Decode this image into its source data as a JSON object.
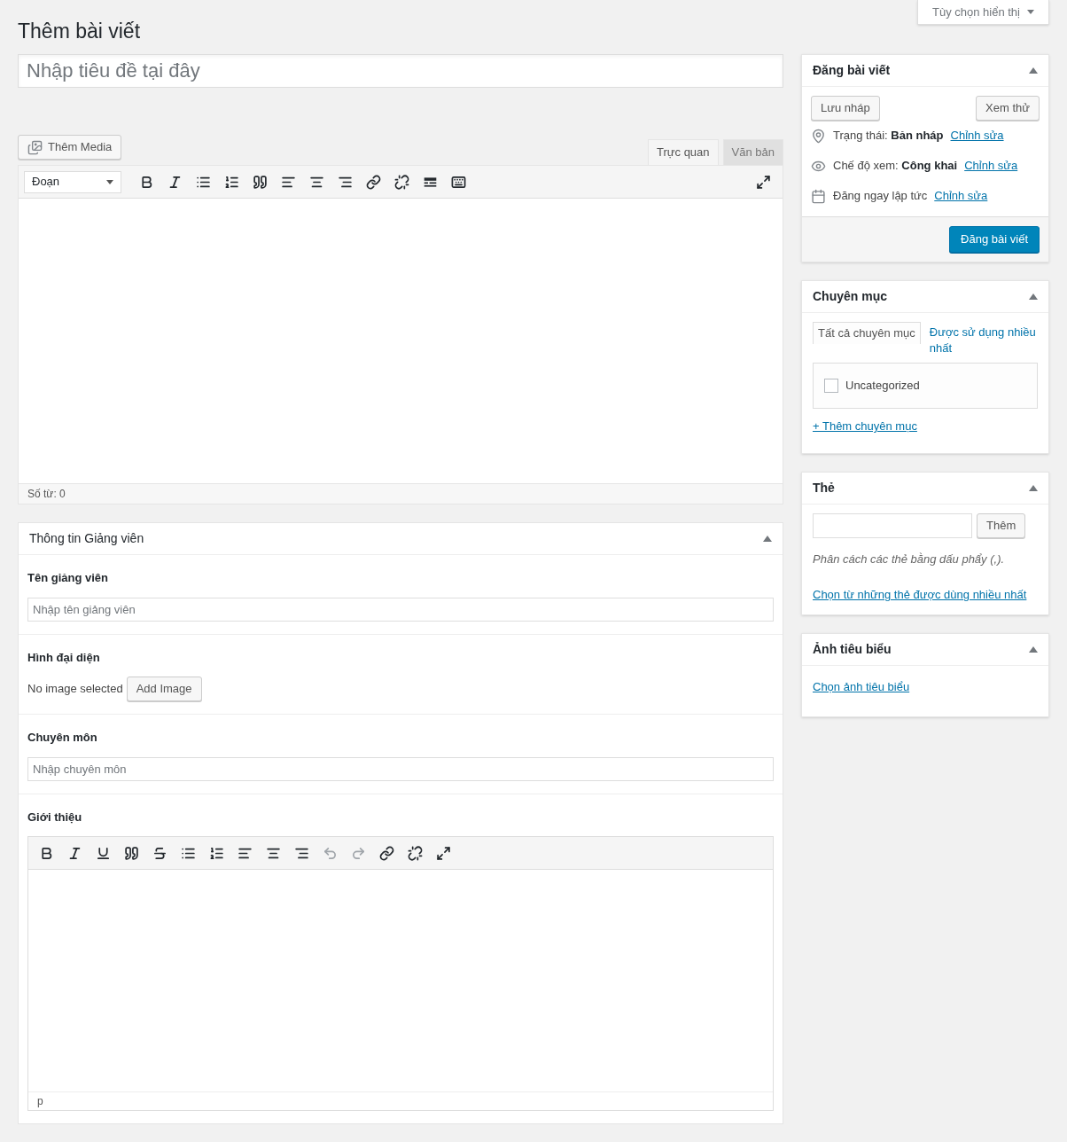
{
  "screen_options": {
    "label": "Tùy chọn hiển thị"
  },
  "page_title": "Thêm bài viết",
  "title_field": {
    "placeholder": "Nhập tiêu đề tại đây"
  },
  "add_media": "Thêm Media",
  "editor_tabs": [
    {
      "label": "Trực quan",
      "selected": true
    },
    {
      "label": "Văn bản",
      "selected": false
    }
  ],
  "format_select": "Đoạn",
  "toolbar": [
    {
      "kind": "bold"
    },
    {
      "kind": "italic"
    },
    {
      "kind": "bullets"
    },
    {
      "kind": "numbers"
    },
    {
      "kind": "quote"
    },
    {
      "kind": "align-left"
    },
    {
      "kind": "align-center"
    },
    {
      "kind": "align-right"
    },
    {
      "kind": "link"
    },
    {
      "kind": "unlink"
    },
    {
      "kind": "more"
    },
    {
      "kind": "kitchen"
    }
  ],
  "word_count": "Số từ: 0",
  "metabox": {
    "title": "Thông tin Giảng viên",
    "fields": [
      {
        "kind": "text",
        "label": "Tên giảng viên",
        "placeholder": "Nhập tên giảng viên"
      },
      {
        "kind": "image",
        "label": "Hình đại diện",
        "status": "No image selected",
        "button": "Add Image"
      },
      {
        "kind": "text",
        "label": "Chuyên môn",
        "placeholder": "Nhập chuyên môn"
      },
      {
        "kind": "editor",
        "label": "Giới thiệu",
        "path": "p",
        "toolbar": [
          {
            "kind": "bold",
            "disabled": false
          },
          {
            "kind": "italic",
            "disabled": false
          },
          {
            "kind": "underline",
            "disabled": false
          },
          {
            "kind": "quote",
            "disabled": false
          },
          {
            "kind": "strike",
            "disabled": false
          },
          {
            "kind": "bullets",
            "disabled": false
          },
          {
            "kind": "numbers",
            "disabled": false
          },
          {
            "kind": "align-left",
            "disabled": false
          },
          {
            "kind": "align-center",
            "disabled": false
          },
          {
            "kind": "align-right",
            "disabled": false
          },
          {
            "kind": "undo",
            "disabled": true
          },
          {
            "kind": "redo",
            "disabled": true
          },
          {
            "kind": "link",
            "disabled": false
          },
          {
            "kind": "unlink",
            "disabled": false
          },
          {
            "kind": "fullscreen",
            "disabled": false
          }
        ]
      }
    ]
  },
  "publish": {
    "title": "Đăng bài viết",
    "save_draft": "Lưu nháp",
    "preview": "Xem thử",
    "rows": [
      {
        "kind": "status",
        "label": "Trạng thái:",
        "value": "Bản nháp",
        "link": "Chỉnh sửa"
      },
      {
        "kind": "visibility",
        "label": "Chế độ xem:",
        "value": "Công khai",
        "link": "Chỉnh sửa"
      },
      {
        "kind": "schedule",
        "label": "Đăng ngay lập tức",
        "link": "Chỉnh sửa"
      }
    ],
    "publish_button": "Đăng bài viết"
  },
  "categories": {
    "title": "Chuyên mục",
    "tabs": [
      {
        "label": "Tất cả chuyên mục",
        "selected": true
      },
      {
        "label": "Được sử dụng nhiều nhất",
        "selected": false
      }
    ],
    "items": [
      {
        "label": "Uncategorized",
        "checked": false
      }
    ],
    "add_link": "+ Thêm chuyên mục"
  },
  "tags": {
    "title": "Thẻ",
    "button": "Thêm",
    "hint": "Phân cách các thẻ bằng dấu phẩy (,).",
    "link": "Chọn từ những thẻ được dùng nhiều nhất"
  },
  "featured_image": {
    "title": "Ảnh tiêu biểu",
    "link": "Chọn ảnh tiêu biểu"
  }
}
